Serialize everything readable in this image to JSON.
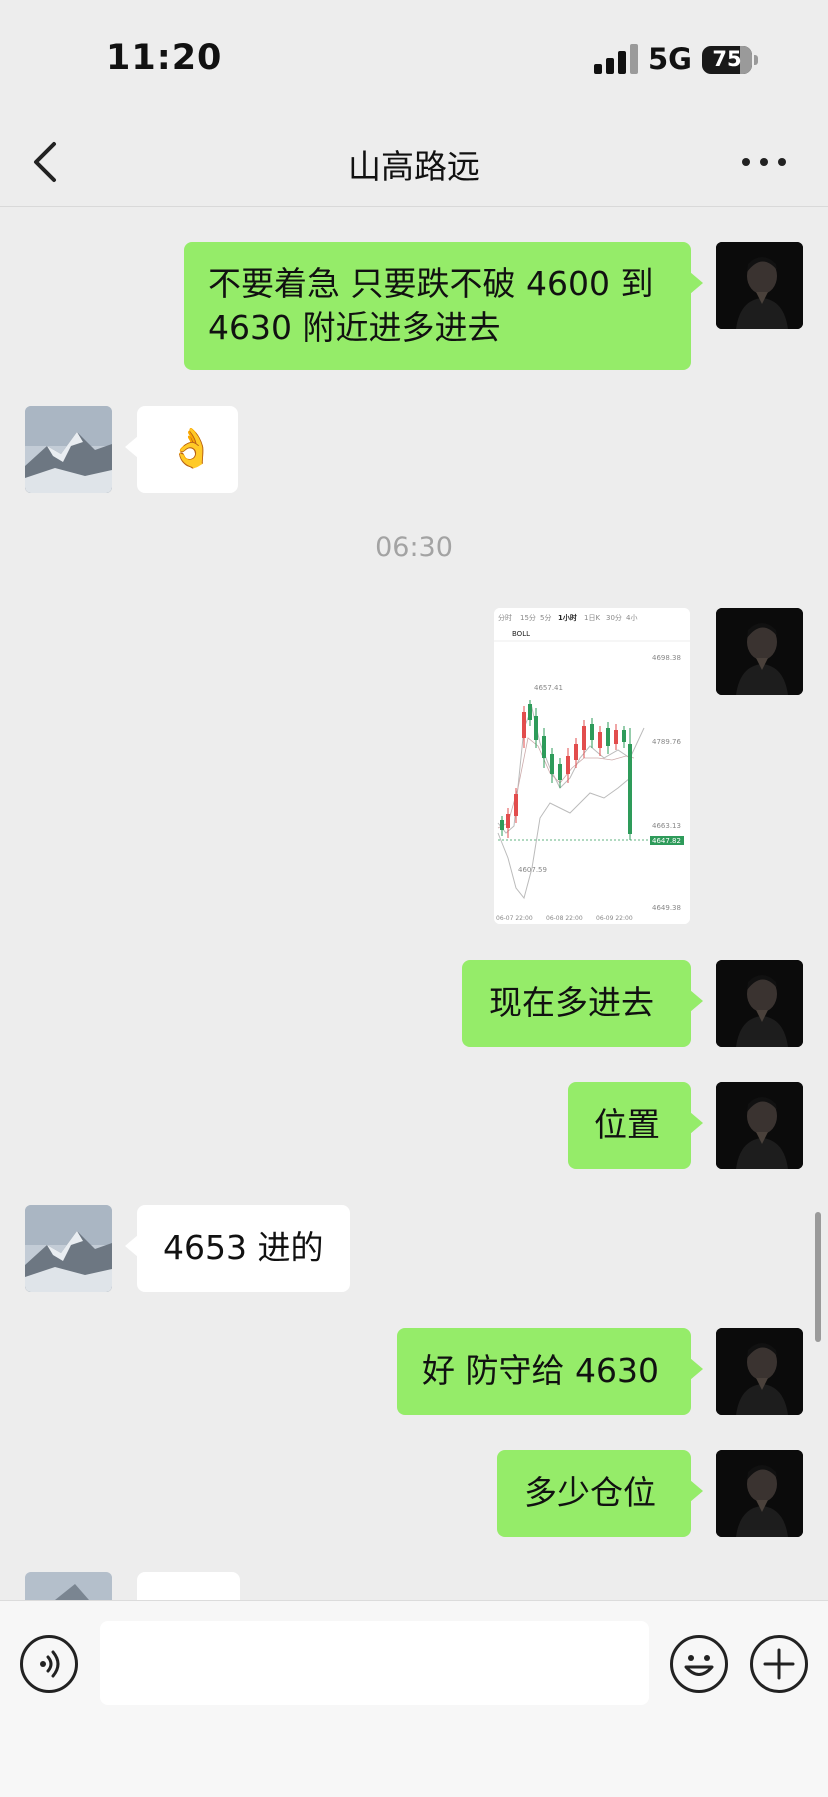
{
  "status": {
    "time": "11:20",
    "network": "5G",
    "battery": "75",
    "battery_fraction": 0.75
  },
  "nav": {
    "title": "山高路远"
  },
  "timestamp": "06:30",
  "messages": [
    {
      "side": "out",
      "type": "text",
      "lines": [
        "不要着急 只要跌不破 4600 到",
        "4630 附近进多进去"
      ]
    },
    {
      "side": "in",
      "type": "emoji",
      "text": "👌"
    },
    {
      "side": "out",
      "type": "image",
      "icon": "kline-chart-screenshot",
      "chart_labels": {
        "tabs": [
          "分时",
          "15分",
          "5分",
          "1小时",
          "1日K",
          "30分",
          "4小"
        ],
        "indicator": "BOLL",
        "price_ticks": [
          "4698.38",
          "4657.41",
          "4789.76",
          "4663.13",
          "4647.82",
          "4607.59",
          "4649.38"
        ],
        "dates": [
          "06-07 22:00",
          "06-08 22:00",
          "06-09 22:00"
        ]
      }
    },
    {
      "side": "out",
      "type": "text",
      "text": "现在多进去"
    },
    {
      "side": "out",
      "type": "text",
      "text": "位置"
    },
    {
      "side": "in",
      "type": "text",
      "text": "4653 进的"
    },
    {
      "side": "out",
      "type": "text",
      "text": "好 防守给 4630"
    },
    {
      "side": "out",
      "type": "text",
      "text": "多少仓位"
    }
  ]
}
